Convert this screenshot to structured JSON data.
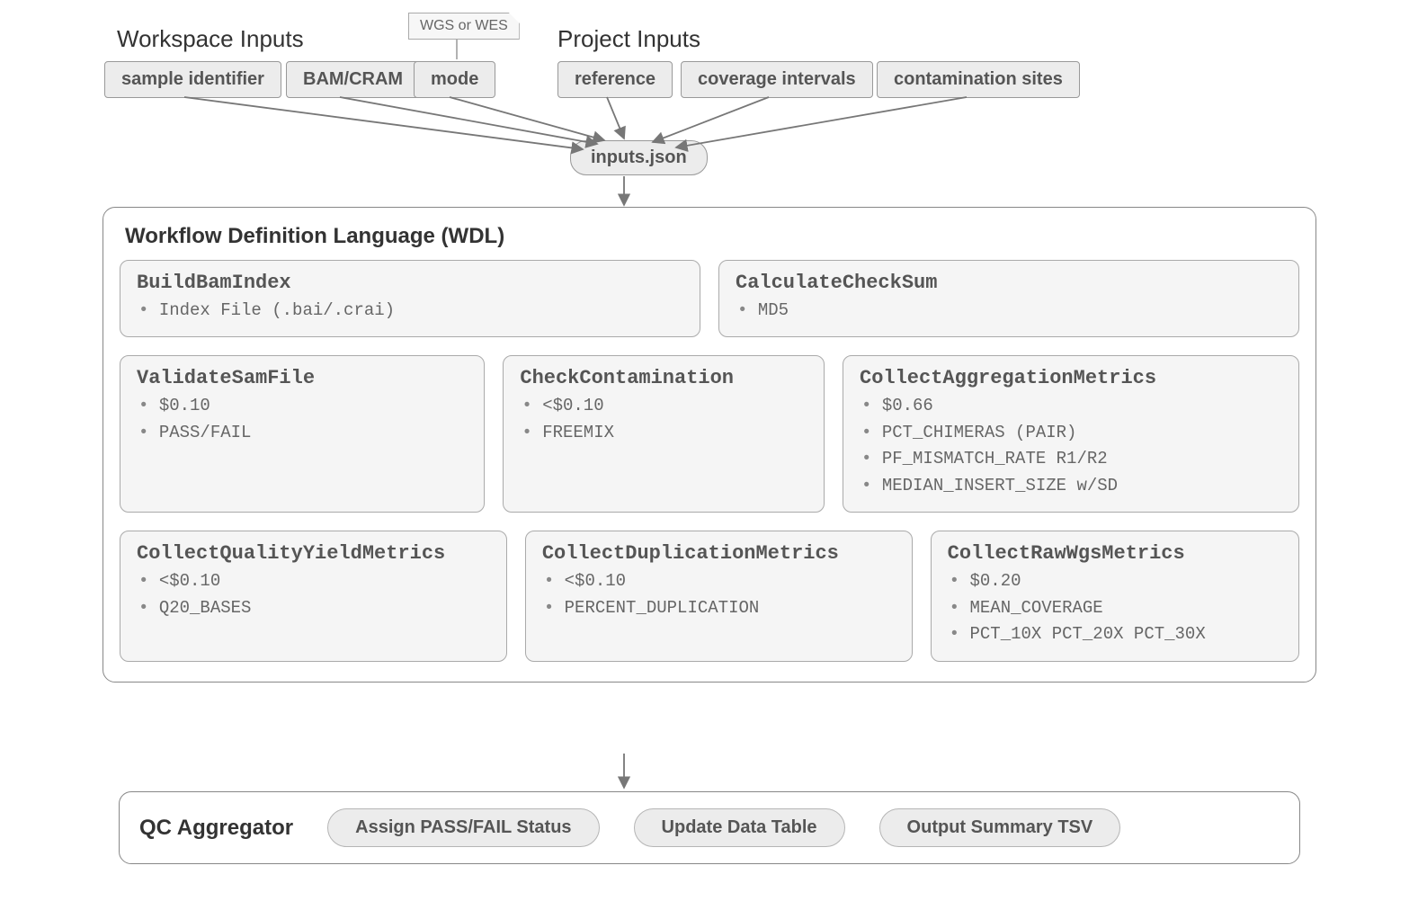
{
  "headers": {
    "workspace": "Workspace Inputs",
    "project": "Project Inputs"
  },
  "note": "WGS or WES",
  "workspace_inputs": {
    "sample": "sample identifier",
    "bam": "BAM/CRAM",
    "mode": "mode"
  },
  "project_inputs": {
    "reference": "reference",
    "coverage": "coverage intervals",
    "contamination": "contamination sites"
  },
  "inputs_json": "inputs.json",
  "wdl": {
    "title": "Workflow Definition Language (WDL)",
    "tasks": {
      "buildbam": {
        "name": "BuildBamIndex",
        "items": [
          "Index File (.bai/.crai)"
        ]
      },
      "checksum": {
        "name": "CalculateCheckSum",
        "items": [
          "MD5"
        ]
      },
      "validate": {
        "name": "ValidateSamFile",
        "items": [
          "$0.10",
          "PASS/FAIL"
        ]
      },
      "checkcontam": {
        "name": "CheckContamination",
        "items": [
          "<$0.10",
          "FREEMIX"
        ]
      },
      "aggmetrics": {
        "name": "CollectAggregationMetrics",
        "items": [
          "$0.66",
          "PCT_CHIMERAS (PAIR)",
          "PF_MISMATCH_RATE R1/R2",
          "MEDIAN_INSERT_SIZE w/SD"
        ]
      },
      "qym": {
        "name": "CollectQualityYieldMetrics",
        "items": [
          "<$0.10",
          "Q20_BASES"
        ]
      },
      "dup": {
        "name": "CollectDuplicationMetrics",
        "items": [
          "<$0.10",
          "PERCENT_DUPLICATION"
        ]
      },
      "rawwgs": {
        "name": "CollectRawWgsMetrics",
        "items": [
          "$0.20",
          "MEAN_COVERAGE",
          "PCT_10X PCT_20X PCT_30X"
        ]
      }
    }
  },
  "qc": {
    "title": "QC Aggregator",
    "items": [
      "Assign PASS/FAIL Status",
      "Update Data Table",
      "Output Summary TSV"
    ]
  }
}
